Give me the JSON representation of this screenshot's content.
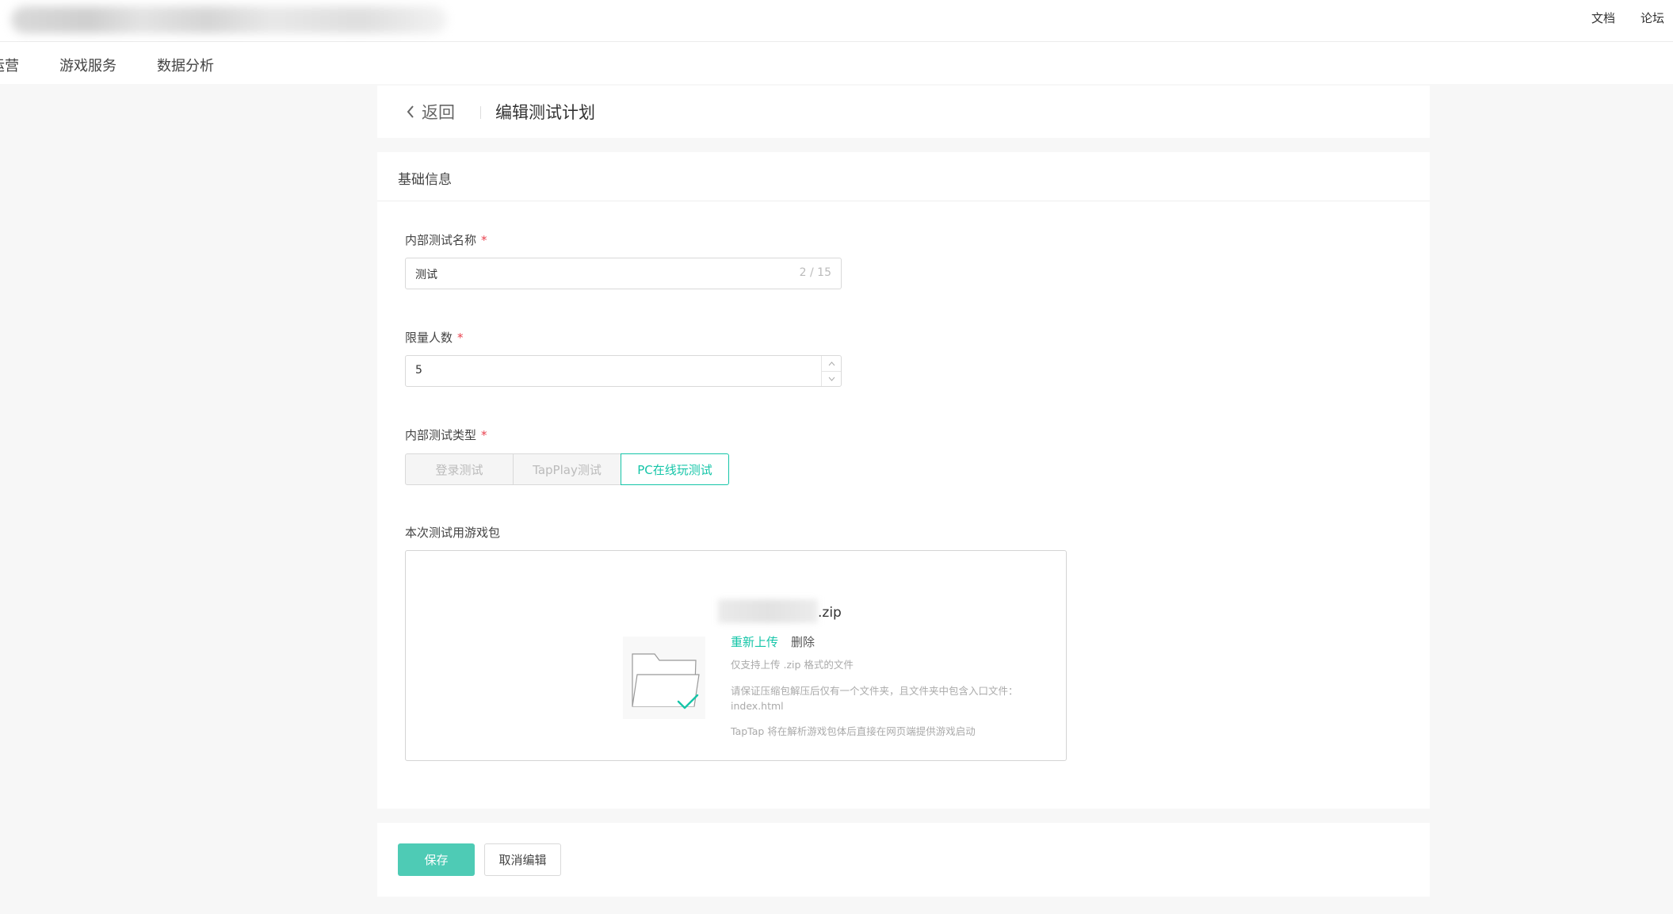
{
  "topbar": {
    "doc_link": "文档",
    "forum_link": "论坛"
  },
  "nav": {
    "items": [
      {
        "label": "运营"
      },
      {
        "label": "游戏服务"
      },
      {
        "label": "数据分析"
      }
    ]
  },
  "header": {
    "back_label": "返回",
    "title": "编辑测试计划"
  },
  "form": {
    "section_title": "基础信息",
    "name_field": {
      "label": "内部测试名称",
      "required_mark": "*",
      "value": "测试",
      "counter": "2 / 15"
    },
    "limit_field": {
      "label": "限量人数",
      "required_mark": "*",
      "value": "5"
    },
    "type_field": {
      "label": "内部测试类型",
      "required_mark": "*",
      "options": [
        "登录测试",
        "TapPlay测试",
        "PC在线玩测试"
      ],
      "selected": "PC在线玩测试"
    },
    "package_field": {
      "label": "本次测试用游戏包",
      "file_ext": ".zip",
      "reupload_label": "重新上传",
      "delete_label": "删除",
      "hint_1": "仅支持上传 .zip 格式的文件",
      "hint_2": "请保证压缩包解压后仅有一个文件夹，且文件夹中包含入口文件：",
      "hint_3": "index.html",
      "hint_4": "TapTap 将在解析游戏包体后直接在网页端提供游戏启动"
    }
  },
  "footer": {
    "save_label": "保存",
    "cancel_label": "取消编辑"
  },
  "colors": {
    "accent": "#15c5a8",
    "save_button": "#4ecbb5",
    "required": "#e9414e",
    "background": "#f7f7f7"
  }
}
